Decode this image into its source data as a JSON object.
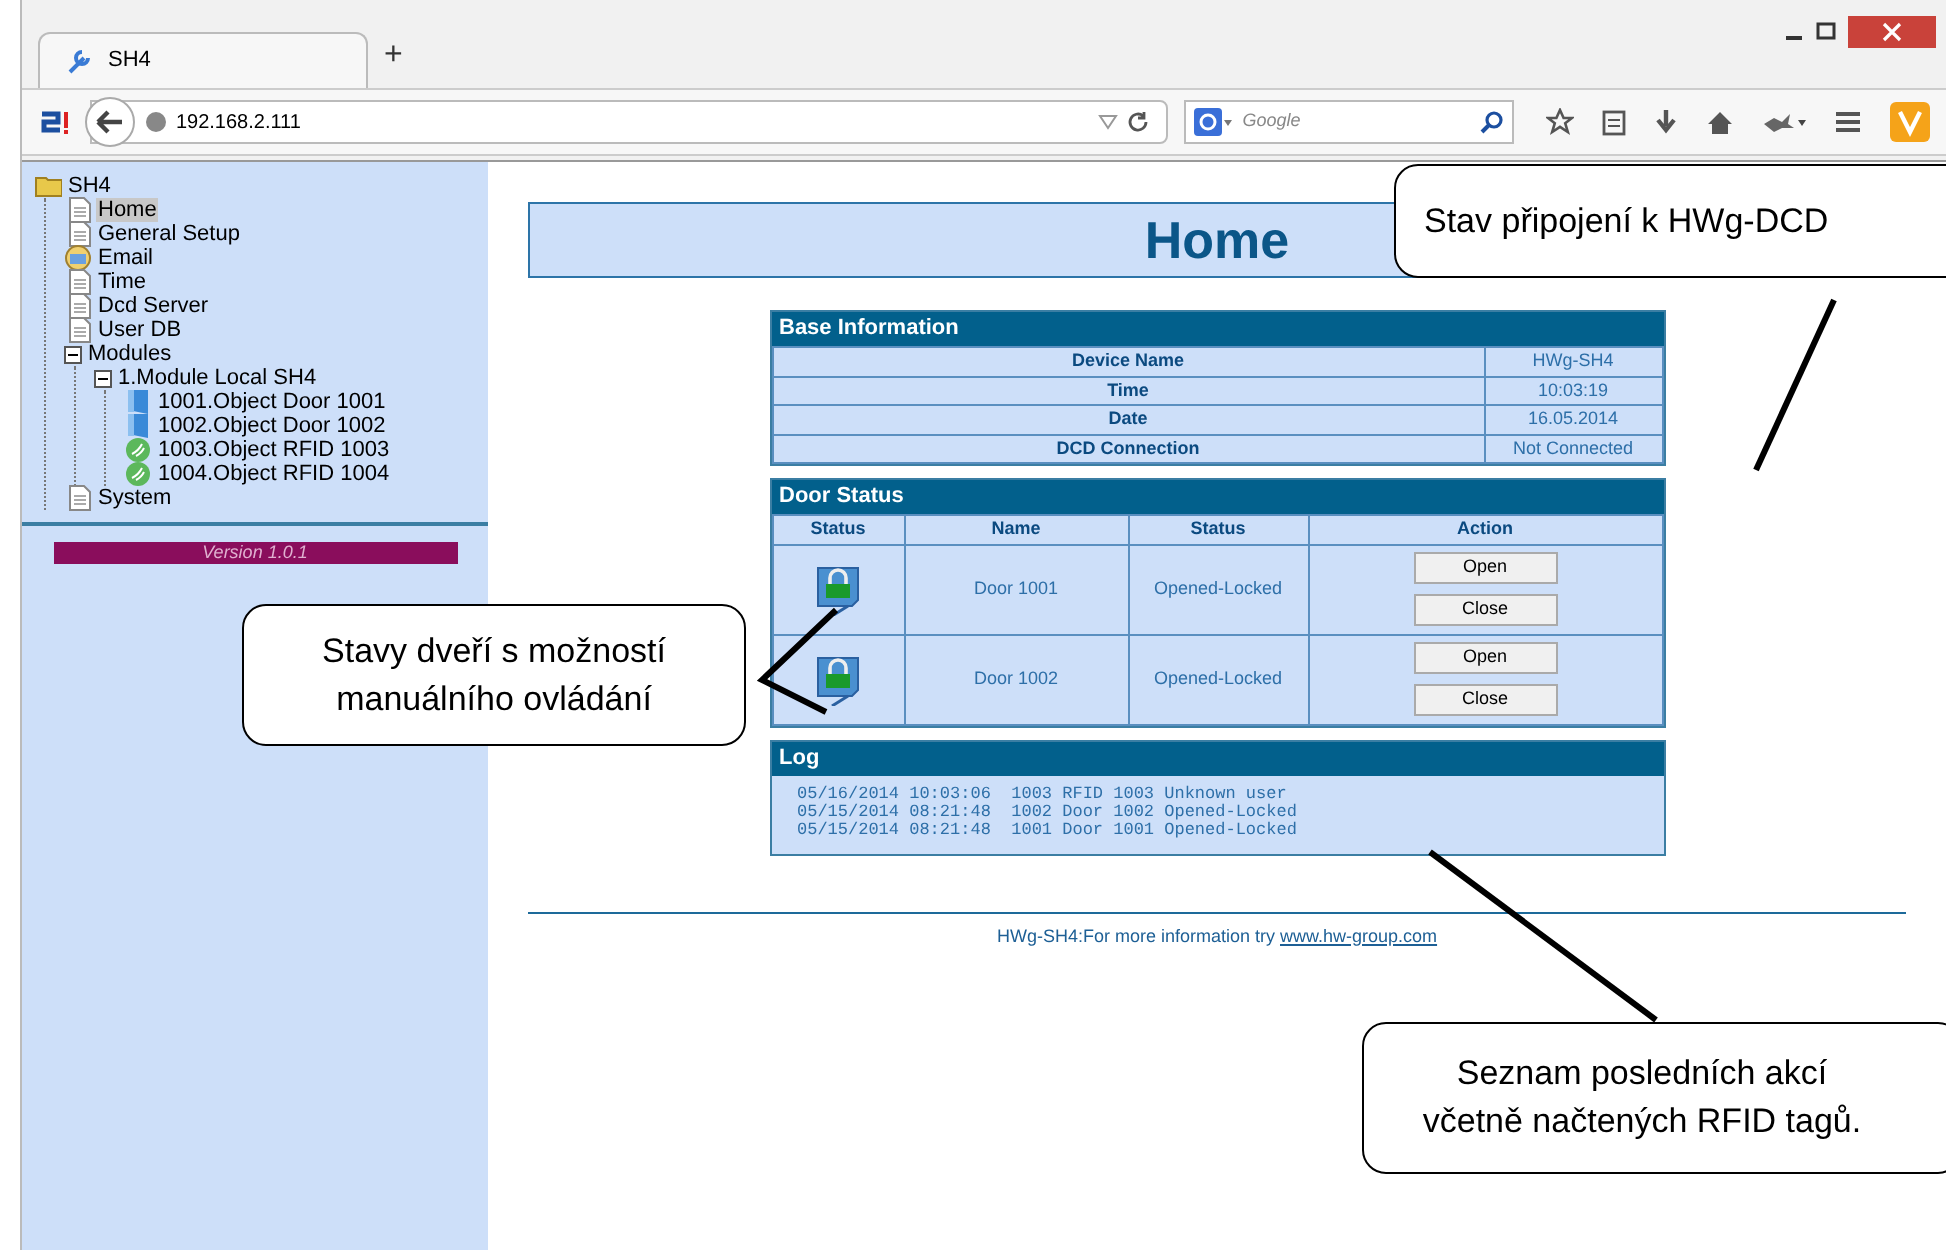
{
  "browser": {
    "tab": {
      "title": "SH4",
      "selected": true
    },
    "new_tab": "+",
    "address": "192.168.2.111",
    "search": {
      "placeholder": "Google"
    }
  },
  "sidebar": {
    "tree": [
      {
        "label": "SH4",
        "kind": "folder",
        "selected": false,
        "children": [
          {
            "label": "Home",
            "kind": "page",
            "selected": true
          },
          {
            "label": "General Setup",
            "kind": "page",
            "selected": false
          },
          {
            "label": "Email",
            "kind": "email",
            "selected": false
          },
          {
            "label": "Time",
            "kind": "page",
            "selected": false
          },
          {
            "label": "Dcd Server",
            "kind": "page",
            "selected": false
          },
          {
            "label": "User DB",
            "kind": "page",
            "selected": false
          },
          {
            "label": "Modules",
            "selected": false,
            "expanded": true,
            "children": [
              {
                "label": "1.Module Local SH4",
                "selected": false,
                "expanded": true,
                "children": [
                  {
                    "label": "1001.Object Door 1001",
                    "kind": "door",
                    "selected": false
                  },
                  {
                    "label": "1002.Object Door 1002",
                    "kind": "door",
                    "selected": false
                  },
                  {
                    "label": "1003.Object RFID 1003",
                    "kind": "rfid",
                    "selected": false
                  },
                  {
                    "label": "1004.Object RFID 1004",
                    "kind": "rfid",
                    "selected": false
                  }
                ]
              }
            ]
          },
          {
            "label": "System",
            "kind": "page",
            "selected": false
          }
        ]
      }
    ],
    "version": "Version 1.0.1"
  },
  "page": {
    "title": "Home",
    "base_info": {
      "heading": "Base Information",
      "rows": [
        {
          "label": "Device Name",
          "value": "HWg-SH4"
        },
        {
          "label": "Time",
          "value": "10:03:19"
        },
        {
          "label": "Date",
          "value": "16.05.2014"
        },
        {
          "label": "DCD Connection",
          "value": "Not Connected"
        }
      ]
    },
    "door_status": {
      "heading": "Door Status",
      "columns": [
        "Status",
        "Name",
        "Status",
        "Action"
      ],
      "rows": [
        {
          "locked": true,
          "name": "Door 1001",
          "status": "Opened-Locked",
          "actions": [
            "Open",
            "Close"
          ]
        },
        {
          "locked": true,
          "name": "Door 1002",
          "status": "Opened-Locked",
          "actions": [
            "Open",
            "Close"
          ]
        }
      ]
    },
    "log": {
      "heading": "Log",
      "lines": [
        "05/16/2014 10:03:06  1003 RFID 1003 Unknown user",
        "05/15/2014 08:21:48  1002 Door 1002 Opened-Locked",
        "05/15/2014 08:21:48  1001 Door 1001 Opened-Locked"
      ]
    },
    "footer": {
      "text": "HWg-SH4:For more information try",
      "link": "www.hw-group.com"
    }
  },
  "callouts": [
    {
      "text": "Stav připojení k HWg-DCD"
    },
    {
      "text": "Stavy dveří s možností manuálního ovládání"
    },
    {
      "text": "Seznam posledních akcí včetně načtených RFID tagů."
    }
  ]
}
